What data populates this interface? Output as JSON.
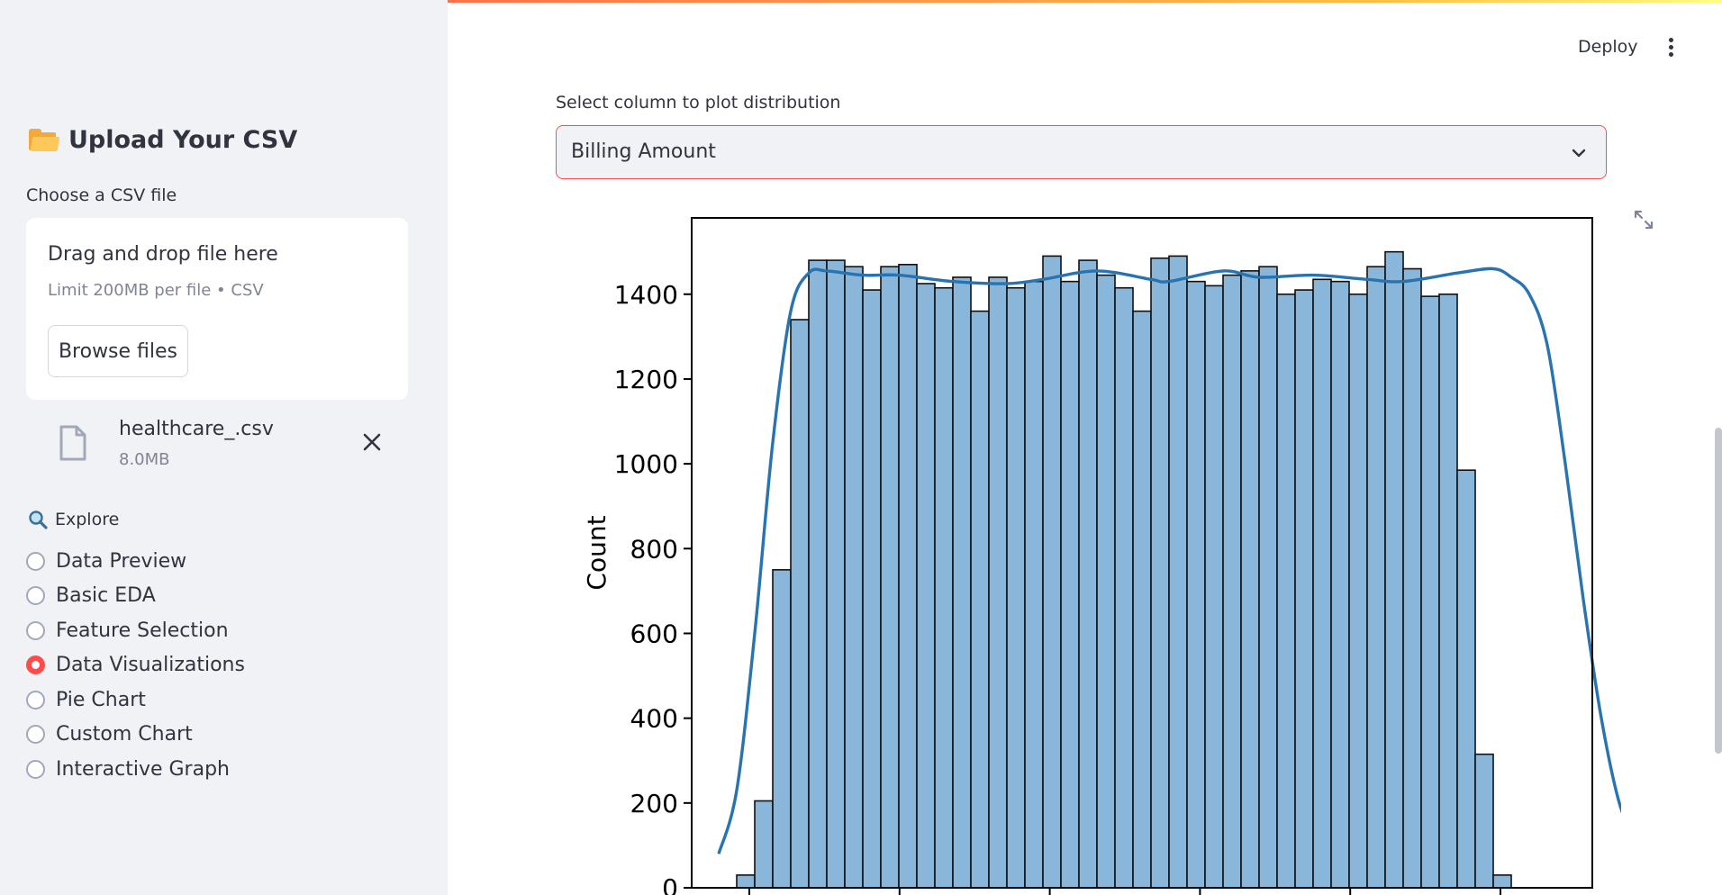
{
  "sidebar": {
    "title": "Upload Your CSV",
    "title_icon": "folder-icon",
    "uploader_label": "Choose a CSV file",
    "dropzone_text": "Drag and drop file here",
    "dropzone_limit": "Limit 200MB per file • CSV",
    "browse_label": "Browse files",
    "file": {
      "name": "healthcare_.csv",
      "size": "8.0MB"
    },
    "explore_label": "Explore",
    "explore_icon": "magnifier-icon",
    "options": [
      {
        "label": "Data Preview",
        "selected": false
      },
      {
        "label": "Basic EDA",
        "selected": false
      },
      {
        "label": "Feature Selection",
        "selected": false
      },
      {
        "label": "Data Visualizations",
        "selected": true
      },
      {
        "label": "Pie Chart",
        "selected": false
      },
      {
        "label": "Custom Chart",
        "selected": false
      },
      {
        "label": "Interactive Graph",
        "selected": false
      }
    ]
  },
  "header": {
    "deploy_label": "Deploy"
  },
  "main": {
    "select_label": "Select column to plot distribution",
    "select_value": "Billing Amount"
  },
  "colors": {
    "accent": "#ff4b4b",
    "bar_fill": "#89b6d9",
    "kde_line": "#2874b0"
  },
  "chart_data": {
    "type": "bar",
    "subtype": "histogram with kde",
    "ylabel": "Count",
    "ylim": [
      0,
      1580
    ],
    "yticks": [
      0,
      200,
      400,
      600,
      800,
      1000,
      1200,
      1400
    ],
    "xlim": [
      -2.5,
      47.5
    ],
    "bins": 44,
    "values": [
      30,
      205,
      750,
      1340,
      1480,
      1480,
      1465,
      1410,
      1465,
      1470,
      1425,
      1415,
      1440,
      1360,
      1440,
      1415,
      1430,
      1490,
      1430,
      1480,
      1445,
      1415,
      1360,
      1485,
      1490,
      1430,
      1420,
      1445,
      1455,
      1465,
      1400,
      1410,
      1435,
      1430,
      1400,
      1465,
      1500,
      1460,
      1395,
      1400,
      985,
      315,
      30
    ],
    "kde": [
      [
        0,
        80
      ],
      [
        1,
        230
      ],
      [
        2,
        600
      ],
      [
        3,
        1050
      ],
      [
        4,
        1360
      ],
      [
        5,
        1450
      ],
      [
        6,
        1455
      ],
      [
        8,
        1445
      ],
      [
        10,
        1445
      ],
      [
        13,
        1430
      ],
      [
        16,
        1425
      ],
      [
        18,
        1435
      ],
      [
        21,
        1455
      ],
      [
        24,
        1435
      ],
      [
        25,
        1430
      ],
      [
        28,
        1455
      ],
      [
        30,
        1440
      ],
      [
        33,
        1445
      ],
      [
        36,
        1435
      ],
      [
        38,
        1430
      ],
      [
        41,
        1450
      ],
      [
        43,
        1460
      ],
      [
        44,
        1440
      ],
      [
        45,
        1400
      ],
      [
        46,
        1280
      ],
      [
        47,
        1000
      ],
      [
        48,
        680
      ],
      [
        49,
        400
      ],
      [
        50,
        200
      ],
      [
        51,
        100
      ]
    ]
  }
}
